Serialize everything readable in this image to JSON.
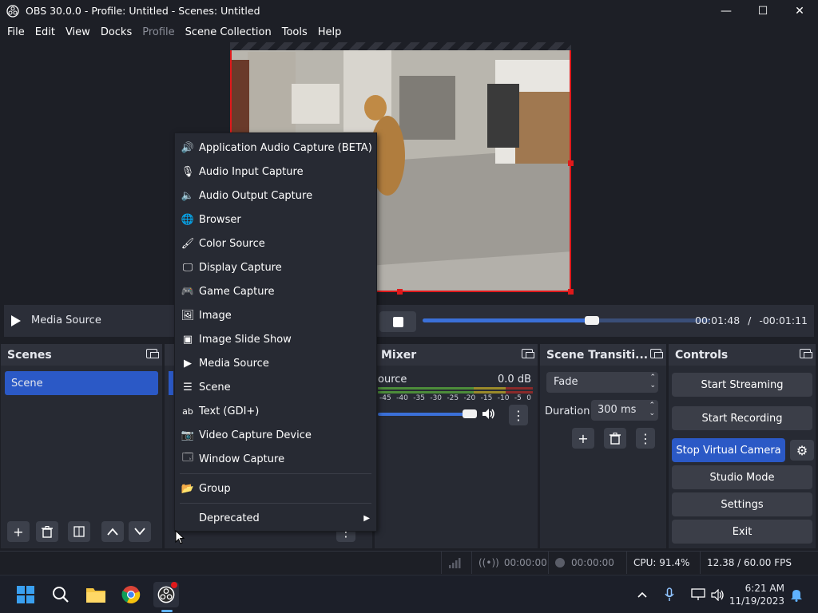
{
  "window": {
    "title": "OBS 30.0.0 - Profile: Untitled - Scenes: Untitled",
    "minimize": "—",
    "maximize": "☐",
    "close": "✕"
  },
  "menubar": [
    "File",
    "Edit",
    "View",
    "Docks",
    "Profile",
    "Scene Collection",
    "Tools",
    "Help"
  ],
  "menubar_disabled": [
    "Profile"
  ],
  "media_controls": {
    "source_label": "Media Source",
    "progress": 0.59,
    "elapsed": "00:01:48",
    "separator": "/",
    "remaining": "-00:01:11"
  },
  "scenes_dock": {
    "title": "Scenes",
    "items": [
      "Scene"
    ],
    "selected": "Scene"
  },
  "mixer_dock": {
    "title": "Mixer",
    "channel": "ource",
    "level": "0.0 dB",
    "ticks": [
      "-45",
      "-40",
      "-35",
      "-30",
      "-25",
      "-20",
      "-15",
      "-10",
      "-5",
      "0"
    ]
  },
  "transitions_dock": {
    "title": "Scene Transiti...",
    "selected": "Fade",
    "duration_label": "Duration",
    "duration_value": "300 ms"
  },
  "controls_dock": {
    "title": "Controls",
    "buttons": [
      "Start Streaming",
      "Start Recording",
      "Stop Virtual Camera",
      "Studio Mode",
      "Settings",
      "Exit"
    ],
    "active_button": "Stop Virtual Camera"
  },
  "add_source_menu": {
    "items": [
      {
        "label": "Application Audio Capture (BETA)",
        "icon": "app-audio-icon"
      },
      {
        "label": "Audio Input Capture",
        "icon": "microphone-icon"
      },
      {
        "label": "Audio Output Capture",
        "icon": "speaker-icon"
      },
      {
        "label": "Browser",
        "icon": "globe-icon"
      },
      {
        "label": "Color Source",
        "icon": "brush-icon"
      },
      {
        "label": "Display Capture",
        "icon": "monitor-icon"
      },
      {
        "label": "Game Capture",
        "icon": "gamepad-icon"
      },
      {
        "label": "Image",
        "icon": "image-icon"
      },
      {
        "label": "Image Slide Show",
        "icon": "slideshow-icon"
      },
      {
        "label": "Media Source",
        "icon": "play-icon"
      },
      {
        "label": "Scene",
        "icon": "list-icon"
      },
      {
        "label": "Text (GDI+)",
        "icon": "text-icon"
      },
      {
        "label": "Video Capture Device",
        "icon": "camera-icon"
      },
      {
        "label": "Window Capture",
        "icon": "window-icon"
      }
    ],
    "group_label": "Group",
    "deprecated_label": "Deprecated"
  },
  "statusbar": {
    "stream_time": "00:00:00",
    "record_time": "00:00:00",
    "cpu": "CPU: 91.4%",
    "fps": "12.38 / 60.00 FPS"
  },
  "taskbar": {
    "time": "6:21 AM",
    "date": "11/19/2023"
  },
  "colors": {
    "accent": "#2b59c6",
    "selection_border": "#e0191b",
    "background": "#1d1f26",
    "dock_bg": "#272a33"
  }
}
